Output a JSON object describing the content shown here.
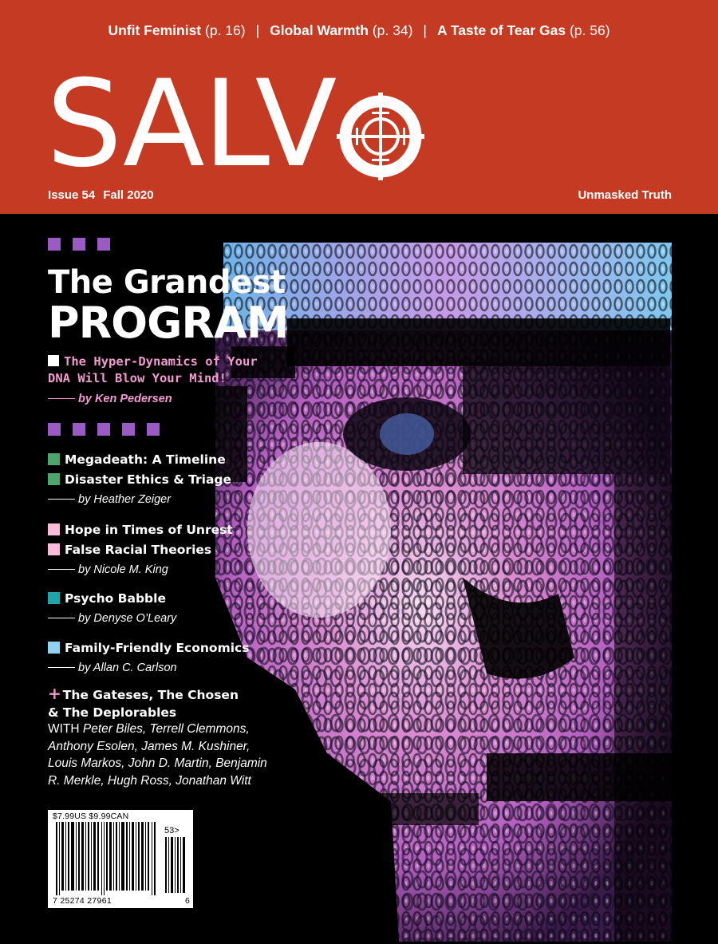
{
  "teasers": [
    {
      "title": "Unfit Feminist",
      "page": "(p. 16)"
    },
    {
      "title": "Global Warmth",
      "page": "(p. 34)"
    },
    {
      "title": "A Taste of Tear Gas",
      "page": "(p. 56)"
    }
  ],
  "teaser_separator": "|",
  "masthead": {
    "logo_text": "SALV",
    "logo_icon": "crosshair-o-icon",
    "issue": "Issue 54",
    "season": "Fall 2020",
    "tagline": "Unmasked Truth"
  },
  "colors": {
    "masthead_red": "#c53a22",
    "background": "#000000",
    "accent_purple": "#9b5bc4",
    "accent_pink": "#f29ad0",
    "bullet_green": "#4fa36d",
    "bullet_pink": "#f6bcd8",
    "bullet_teal": "#22a3a8",
    "bullet_lightblue": "#8fd3f0"
  },
  "feature": {
    "title_line1": "The Grandest",
    "title_line2": "PROGRAM",
    "deck_line1": "The Hyper-Dynamics of Your",
    "deck_line2": "DNA Will Blow Your Mind!",
    "byline": "by Ken Pedersen"
  },
  "cover_lines": [
    {
      "text": "Megadeath: A Timeline",
      "bullet": "green"
    },
    {
      "text": "Disaster Ethics & Triage",
      "bullet": "green"
    },
    {
      "byline": "by Heather Zeiger"
    },
    {
      "text": "Hope in Times of Unrest",
      "bullet": "pink"
    },
    {
      "text": "False Racial Theories",
      "bullet": "pink"
    },
    {
      "byline": "by Nicole M. King"
    },
    {
      "text": "Psycho Babble",
      "bullet": "teal"
    },
    {
      "byline": "by Denyse O’Leary"
    },
    {
      "text": "Family-Friendly Economics",
      "bullet": "lightblue"
    },
    {
      "byline": "by Allan C. Carlson"
    }
  ],
  "plus_item": {
    "symbol": "+",
    "line1": "The Gateses, The Chosen",
    "line2": "& The Deplorables"
  },
  "contributors": {
    "prefix": "WITH",
    "names": "Peter Biles, Terrell Clemmons, Anthony Esolen, James M. Kushiner, Louis Markos, John D. Martin, Benjamin R. Merkle, Hugh Ross, Jonathan Witt"
  },
  "barcode": {
    "price": "$7.99US $9.99CAN",
    "issue_code": "53>",
    "digits": "7  25274  27961",
    "check_digit": "6"
  }
}
